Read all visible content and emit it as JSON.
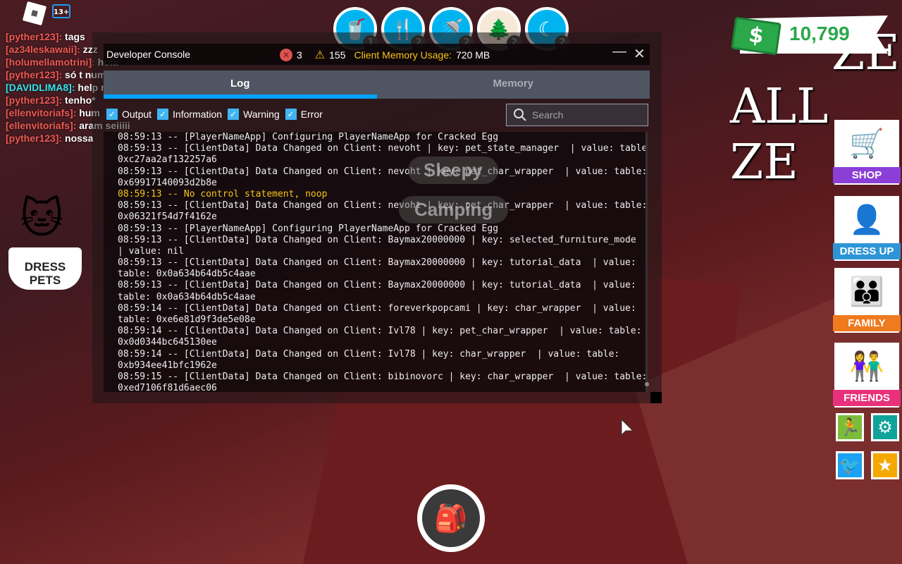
{
  "hud": {
    "age_rating": "13+",
    "chat": [
      {
        "name": "[pyther123]:",
        "msg": "tags"
      },
      {
        "name": "[az34leskawaii]:",
        "msg": "zzz"
      },
      {
        "name": "[holumellamotrini]:",
        "msg": "hola"
      },
      {
        "name": "[pyther123]:",
        "msg": "só t num"
      },
      {
        "name": "[DAVIDLIMA8]:",
        "msg": "help m",
        "highlight": true
      },
      {
        "name": "[pyther123]:",
        "msg": "tenho*"
      },
      {
        "name": "[ellenvitoriafs]:",
        "msg": "hum"
      },
      {
        "name": "[ellenvitoriafs]:",
        "msg": "aram seiiiii"
      },
      {
        "name": "[pyther123]:",
        "msg": "nossa"
      }
    ],
    "needs": [
      {
        "icon": "drink-icon",
        "glyph": "🥤",
        "count": "1"
      },
      {
        "icon": "food-icon",
        "glyph": "🍴",
        "count": "2"
      },
      {
        "icon": "shower-icon",
        "glyph": "🚿",
        "count": "2"
      },
      {
        "icon": "camping-icon",
        "glyph": "🌲",
        "count": "2"
      },
      {
        "icon": "sleep-icon",
        "glyph": "☾",
        "count": "2"
      }
    ],
    "money": "10,799",
    "bg_sign": [
      "ZE",
      "ALL ZE"
    ],
    "world_labels": [
      "Sleepy",
      "Camping"
    ],
    "dress_pets": "DRESS PETS",
    "side_buttons": [
      {
        "label": "SHOP",
        "color": "#8b3fd6",
        "icon": "🛒"
      },
      {
        "label": "DRESS UP",
        "color": "#2d95d6",
        "icon": "👤"
      },
      {
        "label": "FAMILY",
        "color": "#f07a1e",
        "icon": "👪"
      },
      {
        "label": "FRIENDS",
        "color": "#e8317a",
        "icon": "👫"
      }
    ],
    "small_buttons": [
      {
        "icon": "run-icon",
        "glyph": "🏃",
        "color": "#7dbb3a"
      },
      {
        "icon": "gear-icon",
        "glyph": "⚙",
        "color": "#10a39a"
      },
      {
        "icon": "twitter-icon",
        "glyph": "🐦",
        "color": "#1da1f2"
      },
      {
        "icon": "star-icon",
        "glyph": "★",
        "color": "#f5a800"
      }
    ]
  },
  "console": {
    "title": "Developer Console",
    "errors": "3",
    "warnings": "155",
    "memory_label": "Client Memory Usage:",
    "memory_value": "720 MB",
    "tabs": [
      "Log",
      "Memory"
    ],
    "active_tab": "Log",
    "filters": [
      "Output",
      "Information",
      "Warning",
      "Error"
    ],
    "search_placeholder": "Search",
    "log_lines": [
      {
        "text": "08:59:13 -- [PlayerNameApp] Configuring PlayerNameApp for Cracked Egg"
      },
      {
        "text": "08:59:13 -- [ClientData] Data Changed on Client: nevoht | key: pet_state_manager  | value: table:"
      },
      {
        "text": "0xc27aa2af132257a6"
      },
      {
        "text": "08:59:13 -- [ClientData] Data Changed on Client: nevoht | key: pet_char_wrapper  | value: table:"
      },
      {
        "text": "0x69917140093d2b8e"
      },
      {
        "text": "08:59:13 -- No control statement, noop",
        "level": "warning"
      },
      {
        "text": "08:59:13 -- [ClientData] Data Changed on Client: nevoht | key: pet_char_wrapper  | value: table:"
      },
      {
        "text": "0x06321f54d7f4162e"
      },
      {
        "text": "08:59:13 -- [PlayerNameApp] Configuring PlayerNameApp for Cracked Egg"
      },
      {
        "text": "08:59:13 -- [ClientData] Data Changed on Client: Baymax20000000 | key: selected_furniture_mode"
      },
      {
        "text": "| value: nil"
      },
      {
        "text": "08:59:13 -- [ClientData] Data Changed on Client: Baymax20000000 | key: tutorial_data  | value:"
      },
      {
        "text": "table: 0x0a634b64db5c4aae"
      },
      {
        "text": "08:59:13 -- [ClientData] Data Changed on Client: Baymax20000000 | key: tutorial_data  | value:"
      },
      {
        "text": "table: 0x0a634b64db5c4aae"
      },
      {
        "text": "08:59:14 -- [ClientData] Data Changed on Client: foreverkpopcami | key: char_wrapper  | value:"
      },
      {
        "text": "table: 0xe6e81d9f3de5e08e"
      },
      {
        "text": "08:59:14 -- [ClientData] Data Changed on Client: Ivl78 | key: pet_char_wrapper  | value: table:"
      },
      {
        "text": "0x0d0344bc645130ee"
      },
      {
        "text": "08:59:14 -- [ClientData] Data Changed on Client: Ivl78 | key: char_wrapper  | value: table:"
      },
      {
        "text": "0xb934ee41bfc1962e"
      },
      {
        "text": "08:59:15 -- [ClientData] Data Changed on Client: bibinovorc | key: char_wrapper  | value: table:"
      },
      {
        "text": "0xed7106f81d6aec06"
      }
    ]
  }
}
